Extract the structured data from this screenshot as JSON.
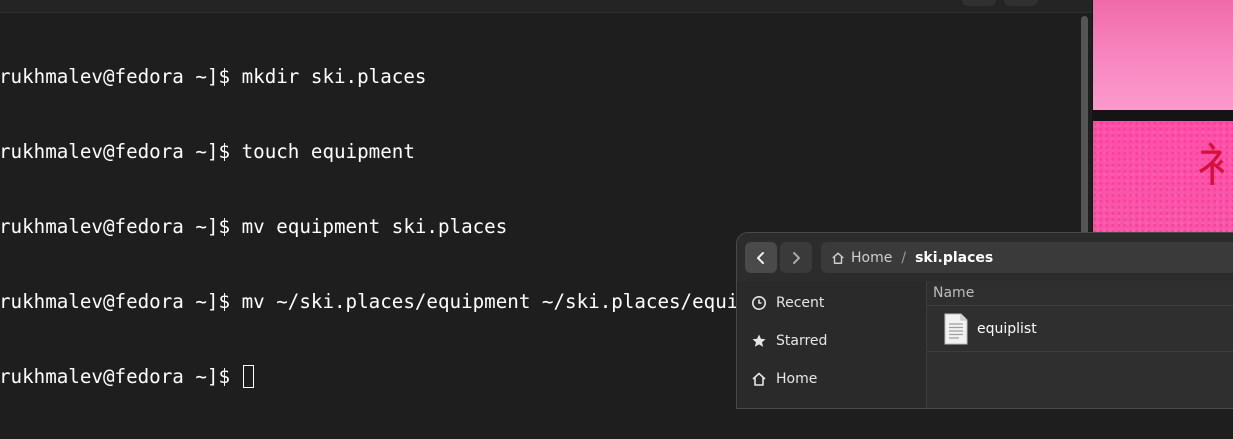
{
  "terminal": {
    "lines": [
      "rukhmalev@fedora ~]$ mkdir ski.places",
      "rukhmalev@fedora ~]$ touch equipment",
      "rukhmalev@fedora ~]$ mv equipment ski.places",
      "rukhmalev@fedora ~]$ mv ~/ski.places/equipment ~/ski.places/equiplist",
      "rukhmalev@fedora ~]$ "
    ]
  },
  "wallpaper": {
    "glyph": "衤",
    "colors": {
      "pink_light": "#f88ac2",
      "pink_hot": "#ff4fa8",
      "red": "#d4113a"
    }
  },
  "files": {
    "icons": {
      "back": "chevron-left-icon",
      "forward": "chevron-right-icon",
      "home": "home-icon"
    },
    "path": {
      "home_label": "Home",
      "separator": "/",
      "current": "ski.places"
    },
    "sidebar": [
      {
        "label": "Recent",
        "icon": "clock-icon"
      },
      {
        "label": "Starred",
        "icon": "star-icon"
      },
      {
        "label": "Home",
        "icon": "home-icon"
      }
    ],
    "columns": {
      "name": "Name"
    },
    "items": [
      {
        "name": "equiplist",
        "icon": "text-file-icon"
      }
    ]
  }
}
